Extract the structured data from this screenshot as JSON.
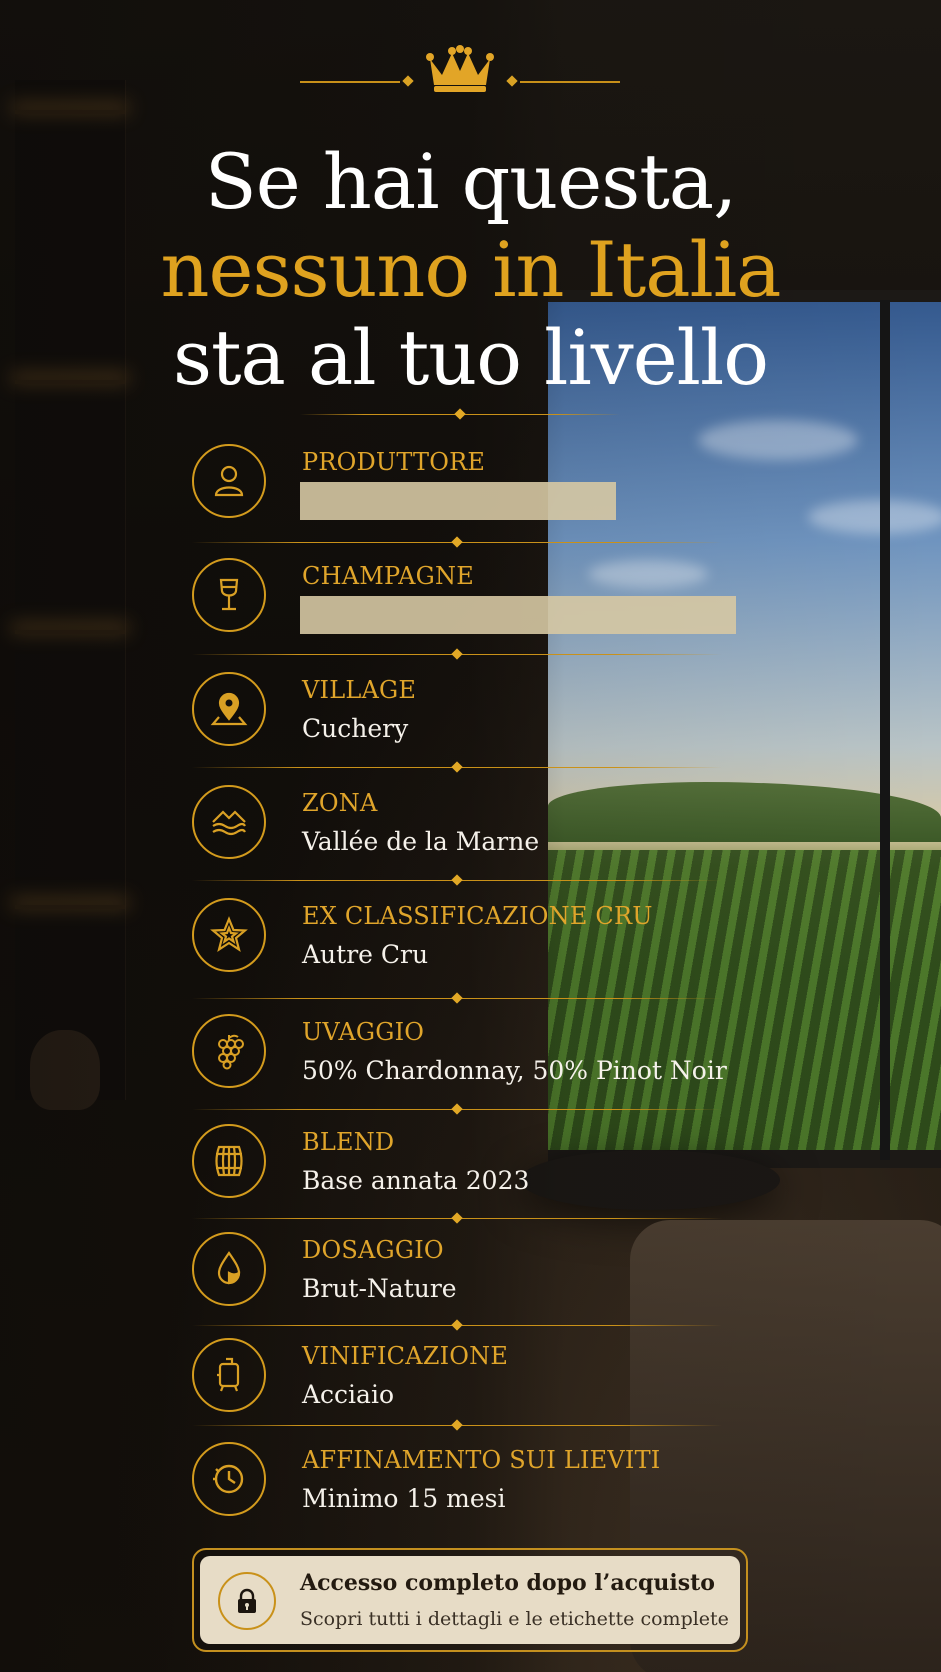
{
  "header": {
    "crown_icon": "crown-icon",
    "line1": "Se hai questa,",
    "line2": "nessuno in Italia",
    "line3": "sta al tuo livello"
  },
  "colors": {
    "gold": "#dfa21f",
    "white": "#ffffff",
    "cta_bg": "#e7dcc6"
  },
  "items": [
    {
      "icon": "person-icon",
      "label": "PRODUTTORE",
      "value": "",
      "redacted": true
    },
    {
      "icon": "wine-glass-icon",
      "label": "CHAMPAGNE",
      "value": "",
      "redacted": true
    },
    {
      "icon": "map-pin-icon",
      "label": "VILLAGE",
      "value": "Cuchery"
    },
    {
      "icon": "waves-mountains-icon",
      "label": "ZONA",
      "value": "Vallée de la Marne"
    },
    {
      "icon": "star-icon",
      "label": "EX CLASSIFICAZIONE CRU",
      "value": "Autre Cru"
    },
    {
      "icon": "grapes-icon",
      "label": "UVAGGIO",
      "value": "50% Chardonnay, 50% Pinot Noir"
    },
    {
      "icon": "barrel-icon",
      "label": "BLEND",
      "value": "Base annata 2023"
    },
    {
      "icon": "drop-icon",
      "label": "DOSAGGIO",
      "value": "Brut-Nature"
    },
    {
      "icon": "steel-tank-icon",
      "label": "VINIFICAZIONE",
      "value": "Acciaio"
    },
    {
      "icon": "clock-icon",
      "label": "AFFINAMENTO SUI LIEVITI",
      "value": "Minimo 15 mesi"
    }
  ],
  "cta": {
    "icon": "lock-icon",
    "title": "Accesso completo dopo l’acquisto",
    "subtitle": "Scopri tutti i dettagli e le etichette complete"
  }
}
